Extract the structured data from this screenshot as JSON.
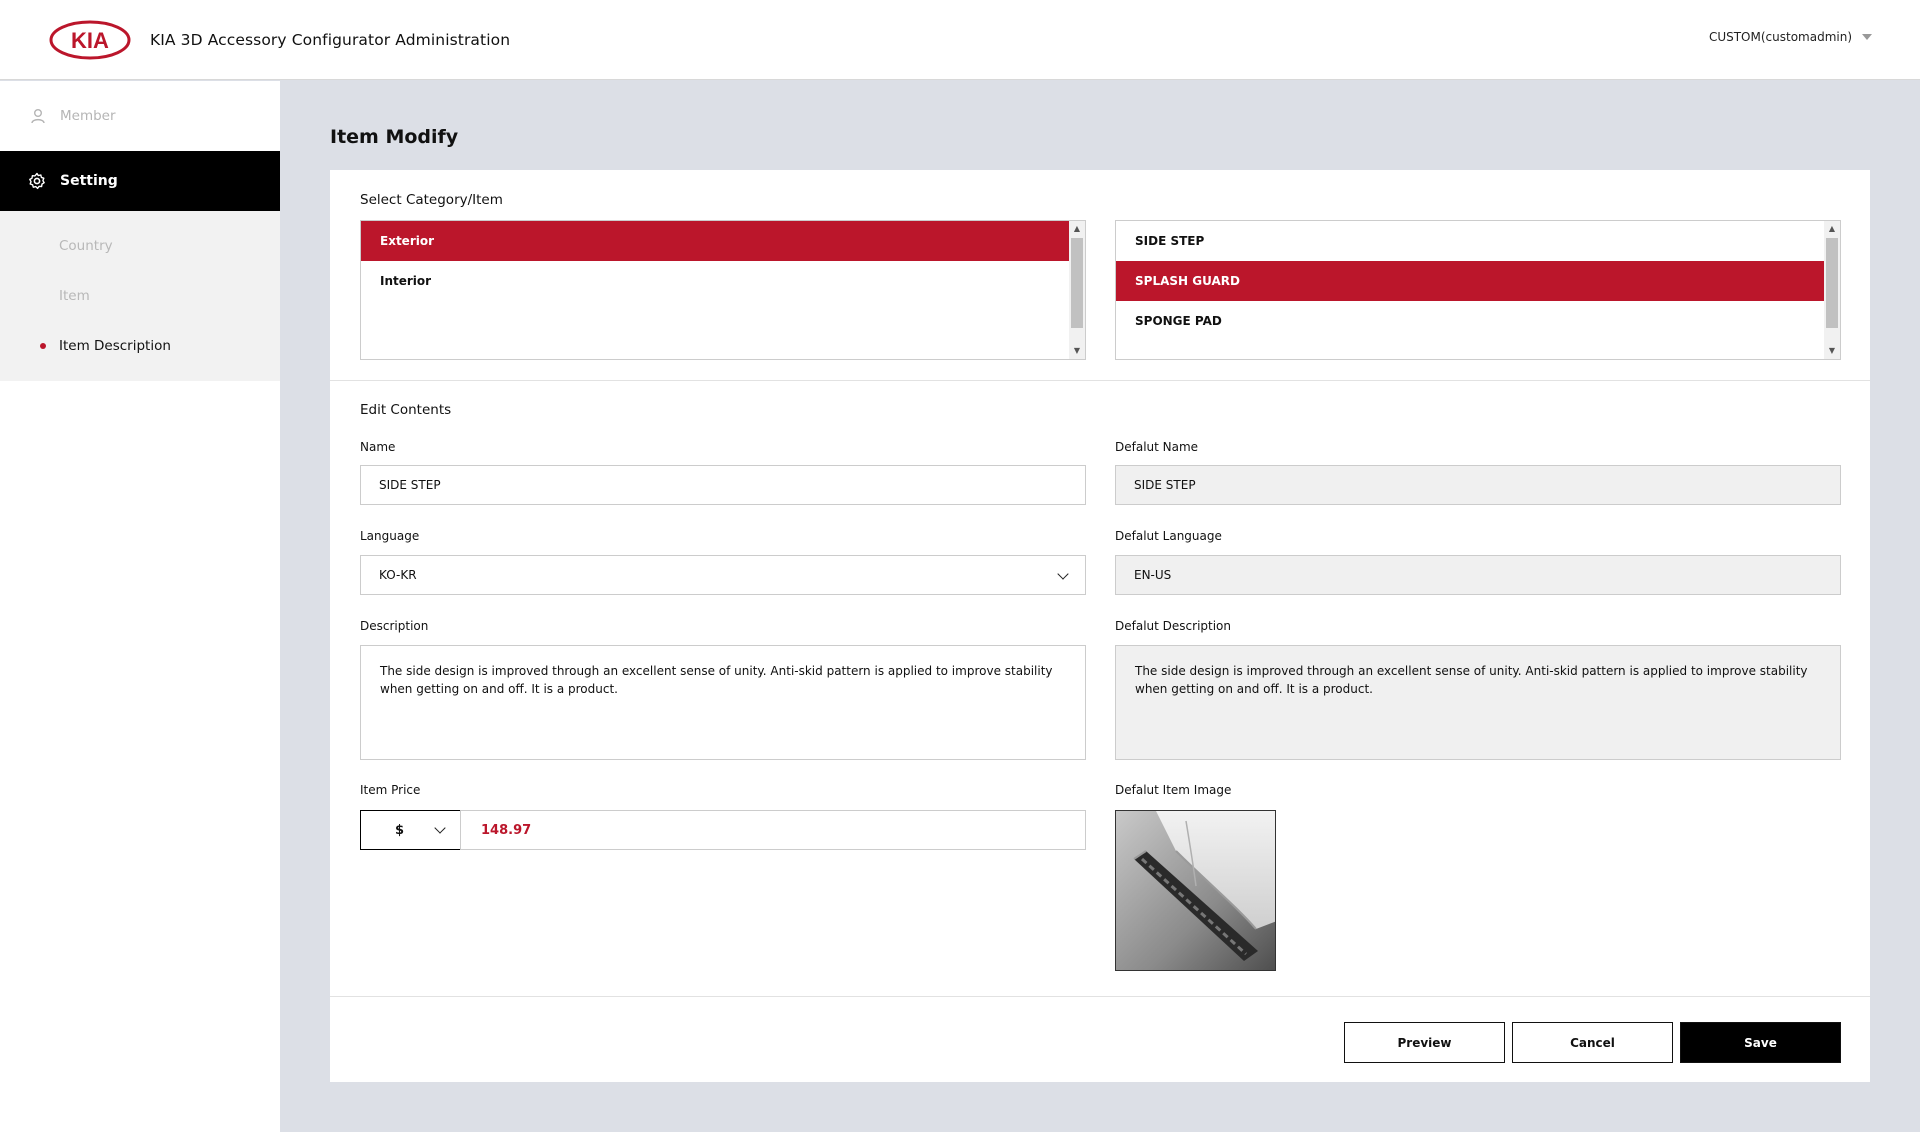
{
  "header": {
    "logo_text": "KIA",
    "app_title": "KIA 3D Accessory Configurator Administration",
    "user": "CUSTOM(customadmin)"
  },
  "sidebar": {
    "member": {
      "label": "Member",
      "icon": "user-icon"
    },
    "setting": {
      "label": "Setting",
      "icon": "gear-icon"
    },
    "subitems": [
      {
        "label": "Country",
        "active": false
      },
      {
        "label": "Item",
        "active": false
      },
      {
        "label": "Item Description",
        "active": true
      }
    ]
  },
  "page": {
    "title": "Item Modify"
  },
  "select_section": {
    "title": "Select Category/Item",
    "categories": [
      {
        "label": "Exterior",
        "selected": true
      },
      {
        "label": "Interior",
        "selected": false
      }
    ],
    "items": [
      {
        "label": "SIDE STEP",
        "selected": false
      },
      {
        "label": "SPLASH GUARD",
        "selected": true
      },
      {
        "label": "SPONGE PAD",
        "selected": false
      }
    ]
  },
  "edit": {
    "title": "Edit Contents",
    "name_label": "Name",
    "name_value": "SIDE STEP",
    "default_name_label": "Defalut Name",
    "default_name_value": "SIDE STEP",
    "language_label": "Language",
    "language_value": "KO-KR",
    "default_language_label": "Defalut Language",
    "default_language_value": "EN-US",
    "description_label": "Description",
    "description_value": "The side design is improved through an excellent sense of unity. Anti-skid pattern is applied to improve stability when getting on and off. It is a product.",
    "default_description_label": "Defalut Description",
    "default_description_value": "The side design is improved through an excellent sense of unity. Anti-skid pattern is applied to improve stability when getting on and off. It is a product.",
    "price_label": "Item Price",
    "currency": "$",
    "price_value": "148.97",
    "default_image_label": "Defalut Item Image"
  },
  "actions": {
    "preview": "Preview",
    "cancel": "Cancel",
    "save": "Save"
  },
  "colors": {
    "brand_red": "#bb162b",
    "black": "#000000",
    "background": "#dcdfe6"
  }
}
